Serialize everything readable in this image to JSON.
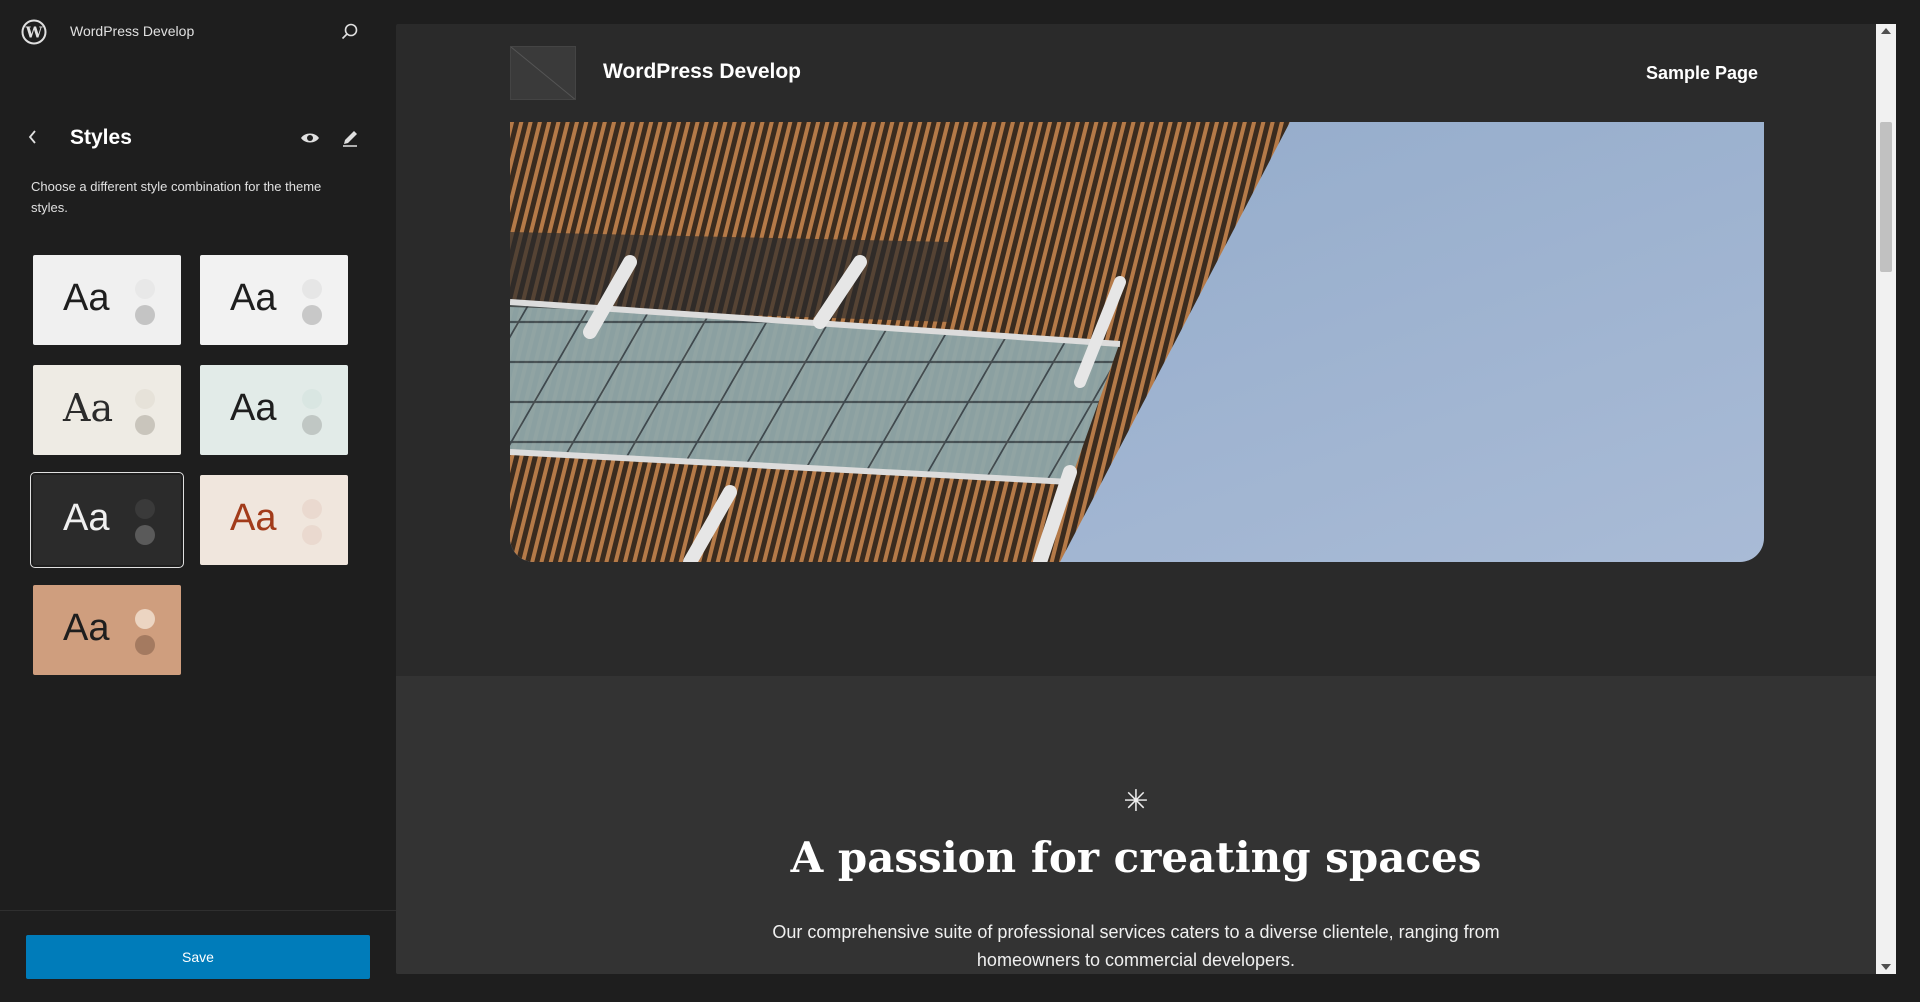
{
  "site_hub": {
    "title": "WordPress Develop",
    "logo_icon": "wordpress-logo-icon",
    "search_icon": "search-icon"
  },
  "styles_panel": {
    "title": "Styles",
    "description": "Choose a different style combination for the theme styles.",
    "variations": [
      {
        "label": "Aa",
        "bg": "#f0f0f0",
        "text_color": "#1e1e1e",
        "dot1": "#e8e8e8",
        "dot2": "#c4c4c4",
        "selected": false
      },
      {
        "label": "Aa",
        "bg": "#f2f2f2",
        "text_color": "#1e1e1e",
        "dot1": "#e6e6e6",
        "dot2": "#c8c8c8",
        "selected": false
      },
      {
        "label": "Aa",
        "bg": "#eeebe4",
        "text_color": "#2b2b2b",
        "dot1": "#e6e2d9",
        "dot2": "#c9c5bc",
        "selected": false
      },
      {
        "label": "Aa",
        "bg": "#e2ebe8",
        "text_color": "#1e1e1e",
        "dot1": "#d9e6e2",
        "dot2": "#c0c7c4",
        "selected": false
      },
      {
        "label": "Aa",
        "bg": "#2b2b2b",
        "text_color": "#f0f0f0",
        "dot1": "#3a3a3a",
        "dot2": "#5a5a5a",
        "selected": true
      },
      {
        "label": "Aa",
        "bg": "#f0e6dd",
        "text_color": "#a23b1a",
        "dot1": "#ead9cf",
        "dot2": "#ead9cf",
        "selected": false
      },
      {
        "label": "Aa",
        "bg": "#cf9e7e",
        "text_color": "#1e1e1e",
        "dot1": "#ecd5c2",
        "dot2": "#a47a60",
        "selected": false
      }
    ]
  },
  "save_label": "Save",
  "preview": {
    "site_name": "WordPress Develop",
    "nav_link": "Sample Page",
    "headline": "A passion for creating spaces",
    "subtext": "Our comprehensive suite of professional services caters to a diverse clientele, ranging from homeowners to commercial developers.",
    "asterisk": "✳"
  },
  "colors": {
    "accent": "#007cba",
    "canvas_bg": "#2a2a2a",
    "section_bg": "#333333"
  }
}
